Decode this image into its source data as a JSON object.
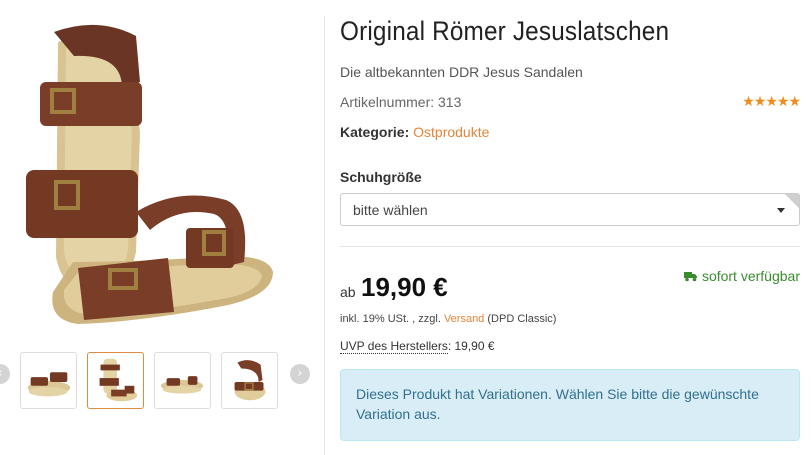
{
  "gallery": {
    "main_image_alt": "Sandalen",
    "thumbnails": [
      "thumb-1",
      "thumb-2",
      "thumb-3",
      "thumb-4"
    ],
    "active_thumbnail": 2,
    "prev_arrow": "chevron-left-icon",
    "next_arrow": "chevron-right-icon"
  },
  "product": {
    "title": "Original Römer Jesuslatschen",
    "subtitle": "Die altbekannten DDR Jesus Sandalen",
    "article_number": "Artikelnummer: 313",
    "rating_stars": "★★★★★",
    "rating_fraction": 0.9,
    "category_label": "Kategorie:",
    "category_link": "Ostprodukte"
  },
  "variation": {
    "label": "Schuhgröße",
    "selected": "bitte wählen"
  },
  "price": {
    "prefix": "ab",
    "value": "19,90 €",
    "availability": "sofort verfügbar",
    "tax_prefix": "inkl. 19% USt. , zzgl.",
    "shipping_link": "Versand",
    "shipping_suffix": "(DPD Classic)",
    "uvp_label": "UVP des Herstellers",
    "uvp_value": ": 19,90 €"
  },
  "alert": {
    "text": "Dieses Produkt hat Variationen. Wählen Sie bitte die gewünschte Variation aus."
  },
  "colors": {
    "accent": "#e5843a",
    "available": "#3a8c2f",
    "alert_bg": "#d9edf7",
    "alert_text": "#31708f",
    "stars": "#f08c1c"
  }
}
